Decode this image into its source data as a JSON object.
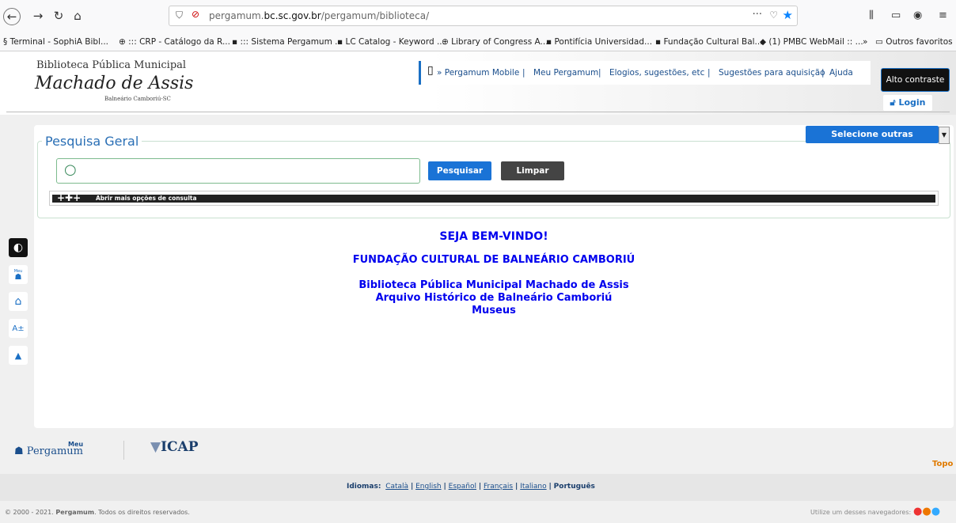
{
  "browser": {
    "url_host": "pergamum.bc.sc.gov.br",
    "url_path": "/pergamum/biblioteca/",
    "url_prefix": "pergamum.",
    "url_domain": "bc.sc.gov.br",
    "dots": "···"
  },
  "bookmarks": [
    "Terminal - SophiA Bibl...",
    "::: CRP - Catálogo da R...",
    "::: Sistema Pergamum ...",
    "LC Catalog - Keyword ...",
    "Library of Congress A...",
    "Pontifícia Universidad...",
    "Fundação Cultural Bal...",
    "(1) PMBC WebMail :: ...",
    "Outros favoritos"
  ],
  "header": {
    "logo_line1": "Biblioteca Pública Municipal",
    "logo_line2": "Machado de Assis",
    "logo_line3": "Balneário Camboriú-SC",
    "menu": [
      "» Pergamum Mobile",
      "|",
      "Meu Pergamum",
      "|",
      "Elogios, sugestões, etc",
      "|",
      "Sugestões para aquisição",
      "|",
      "Ajuda"
    ],
    "alto_contraste": "Alto contraste",
    "login": "Login"
  },
  "search": {
    "legend": "Pesquisa Geral",
    "select_other": "Selecione outras pesquisas",
    "placeholder": "",
    "btn_search": "Pesquisar",
    "btn_clear": "Limpar",
    "more_options": "Abrir mais opções de consulta"
  },
  "welcome": {
    "line1": "SEJA BEM-VINDO!",
    "line2": "FUNDAÇÃO CULTURAL DE BALNEÁRIO CAMBORIÚ",
    "line3": "Biblioteca Pública Municipal Machado de Assis",
    "line4": "Arquivo Histórico de Balneário Camboriú",
    "line5": "Museus"
  },
  "sidebar": {
    "contrast_icon": "contrast-icon",
    "meu_label": "Meu",
    "items": [
      "contrast-icon",
      "meu-pergamum-icon",
      "home-icon",
      "font-size-icon",
      "scroll-top-icon"
    ]
  },
  "footer": {
    "meu_pergamum_small": "Meu",
    "meu_pergamum_big": "Pergamum",
    "icap": "ICAP",
    "topo": "Topo",
    "idiomas_label": "Idiomas:",
    "languages": [
      "Català",
      "English",
      "Español",
      "Français",
      "Italiano",
      "Português"
    ],
    "copyright_prefix": "© 2000 - 2021.",
    "copyright_brand": "Pergamum",
    "copyright_suffix": ". Todos os direitos reservados.",
    "browsers_text": "Utilize um desses navegadores:"
  }
}
